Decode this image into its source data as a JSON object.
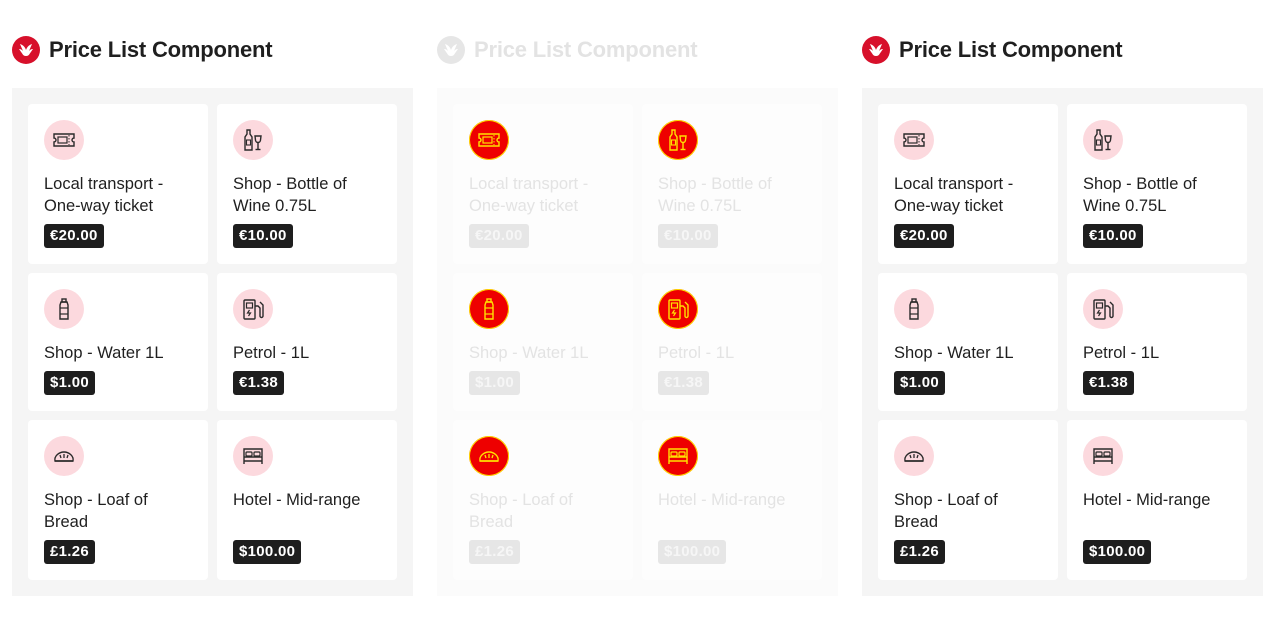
{
  "colors": {
    "brand_red": "#d7102b",
    "icon_bg": "#fcd9de",
    "price_bg": "#1e1e1e",
    "faded_icon_bg": "#ee0000",
    "faded_icon_stroke": "#ffe100"
  },
  "panels": [
    {
      "title": "Price List Component",
      "logo_icon": "bird-logo-icon",
      "items": [
        {
          "label": "Local transport - One-way ticket",
          "price": "€20.00",
          "icon": "ticket-icon"
        },
        {
          "label": "Shop - Bottle of Wine 0.75L",
          "price": "€10.00",
          "icon": "wine-bottle-icon"
        },
        {
          "label": "Shop - Water 1L",
          "price": "$1.00",
          "icon": "water-bottle-icon"
        },
        {
          "label": "Petrol - 1L",
          "price": "€1.38",
          "icon": "fuel-pump-icon"
        },
        {
          "label": "Shop - Loaf of Bread",
          "price": "£1.26",
          "icon": "bread-icon"
        },
        {
          "label": "Hotel - Mid-range",
          "price": "$100.00",
          "icon": "bed-icon"
        }
      ]
    },
    {
      "title": "Price List Component",
      "logo_icon": "bird-logo-icon",
      "items": [
        {
          "label": "Local transport - One-way ticket",
          "price": "€20.00",
          "icon": "ticket-icon"
        },
        {
          "label": "Shop - Bottle of Wine 0.75L",
          "price": "€10.00",
          "icon": "wine-bottle-icon"
        },
        {
          "label": "Shop - Water 1L",
          "price": "$1.00",
          "icon": "water-bottle-icon"
        },
        {
          "label": "Petrol - 1L",
          "price": "€1.38",
          "icon": "fuel-pump-icon"
        },
        {
          "label": "Shop - Loaf of Bread",
          "price": "£1.26",
          "icon": "bread-icon"
        },
        {
          "label": "Hotel - Mid-range",
          "price": "$100.00",
          "icon": "bed-icon"
        }
      ]
    },
    {
      "title": "Price List Component",
      "logo_icon": "bird-logo-icon",
      "items": [
        {
          "label": "Local transport - One-way ticket",
          "price": "€20.00",
          "icon": "ticket-icon"
        },
        {
          "label": "Shop - Bottle of Wine 0.75L",
          "price": "€10.00",
          "icon": "wine-bottle-icon"
        },
        {
          "label": "Shop - Water 1L",
          "price": "$1.00",
          "icon": "water-bottle-icon"
        },
        {
          "label": "Petrol - 1L",
          "price": "€1.38",
          "icon": "fuel-pump-icon"
        },
        {
          "label": "Shop - Loaf of Bread",
          "price": "£1.26",
          "icon": "bread-icon"
        },
        {
          "label": "Hotel - Mid-range",
          "price": "$100.00",
          "icon": "bed-icon"
        }
      ]
    }
  ]
}
